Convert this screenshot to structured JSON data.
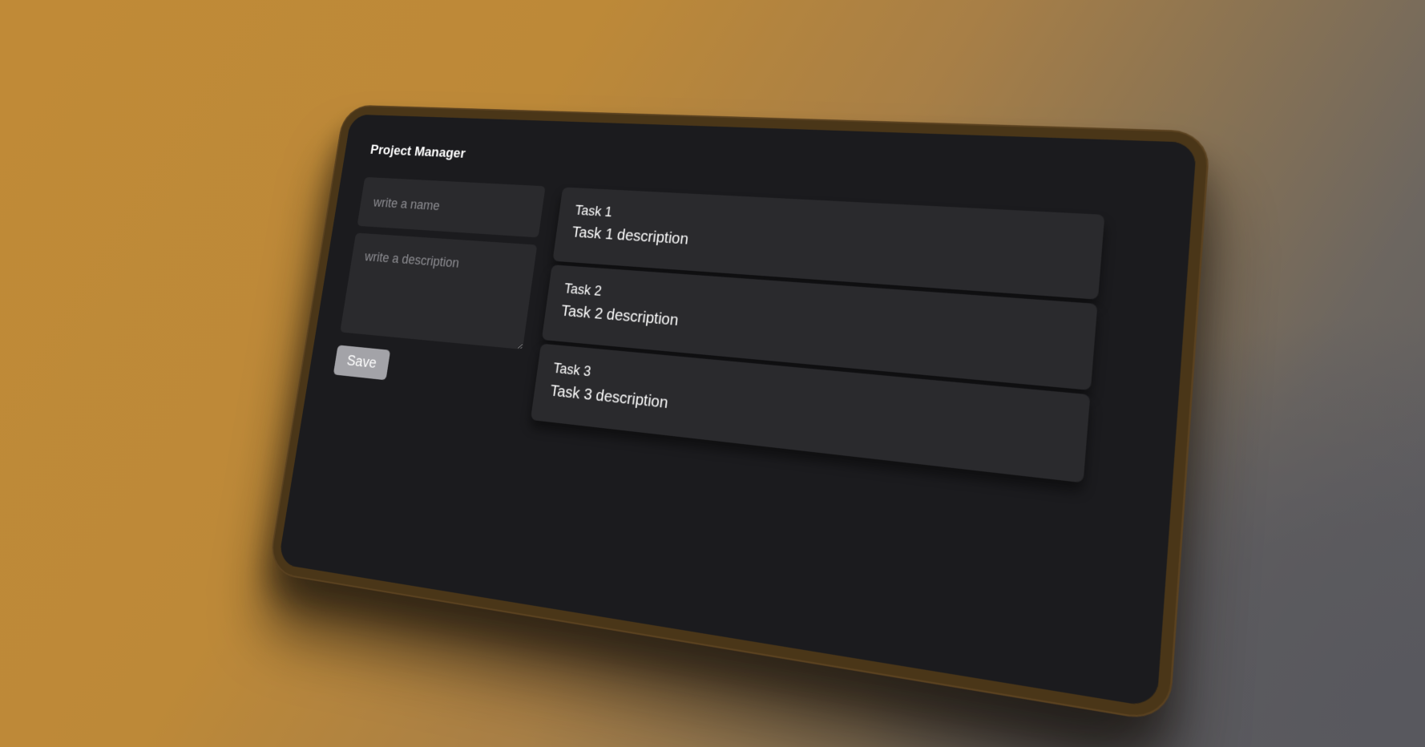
{
  "app": {
    "title": "Project Manager"
  },
  "form": {
    "name_placeholder": "write a name",
    "name_value": "",
    "description_placeholder": "write a description",
    "description_value": "",
    "save_label": "Save"
  },
  "tasks": [
    {
      "name": "Task 1",
      "description": "Task 1 description"
    },
    {
      "name": "Task 2",
      "description": "Task 2 description"
    },
    {
      "name": "Task 3",
      "description": "Task 3 description"
    }
  ],
  "colors": {
    "panel_background": "#1b1b1e",
    "card_background": "#2a2a2d",
    "save_button": "#a3a3a8",
    "bezel": "#4a3618"
  }
}
